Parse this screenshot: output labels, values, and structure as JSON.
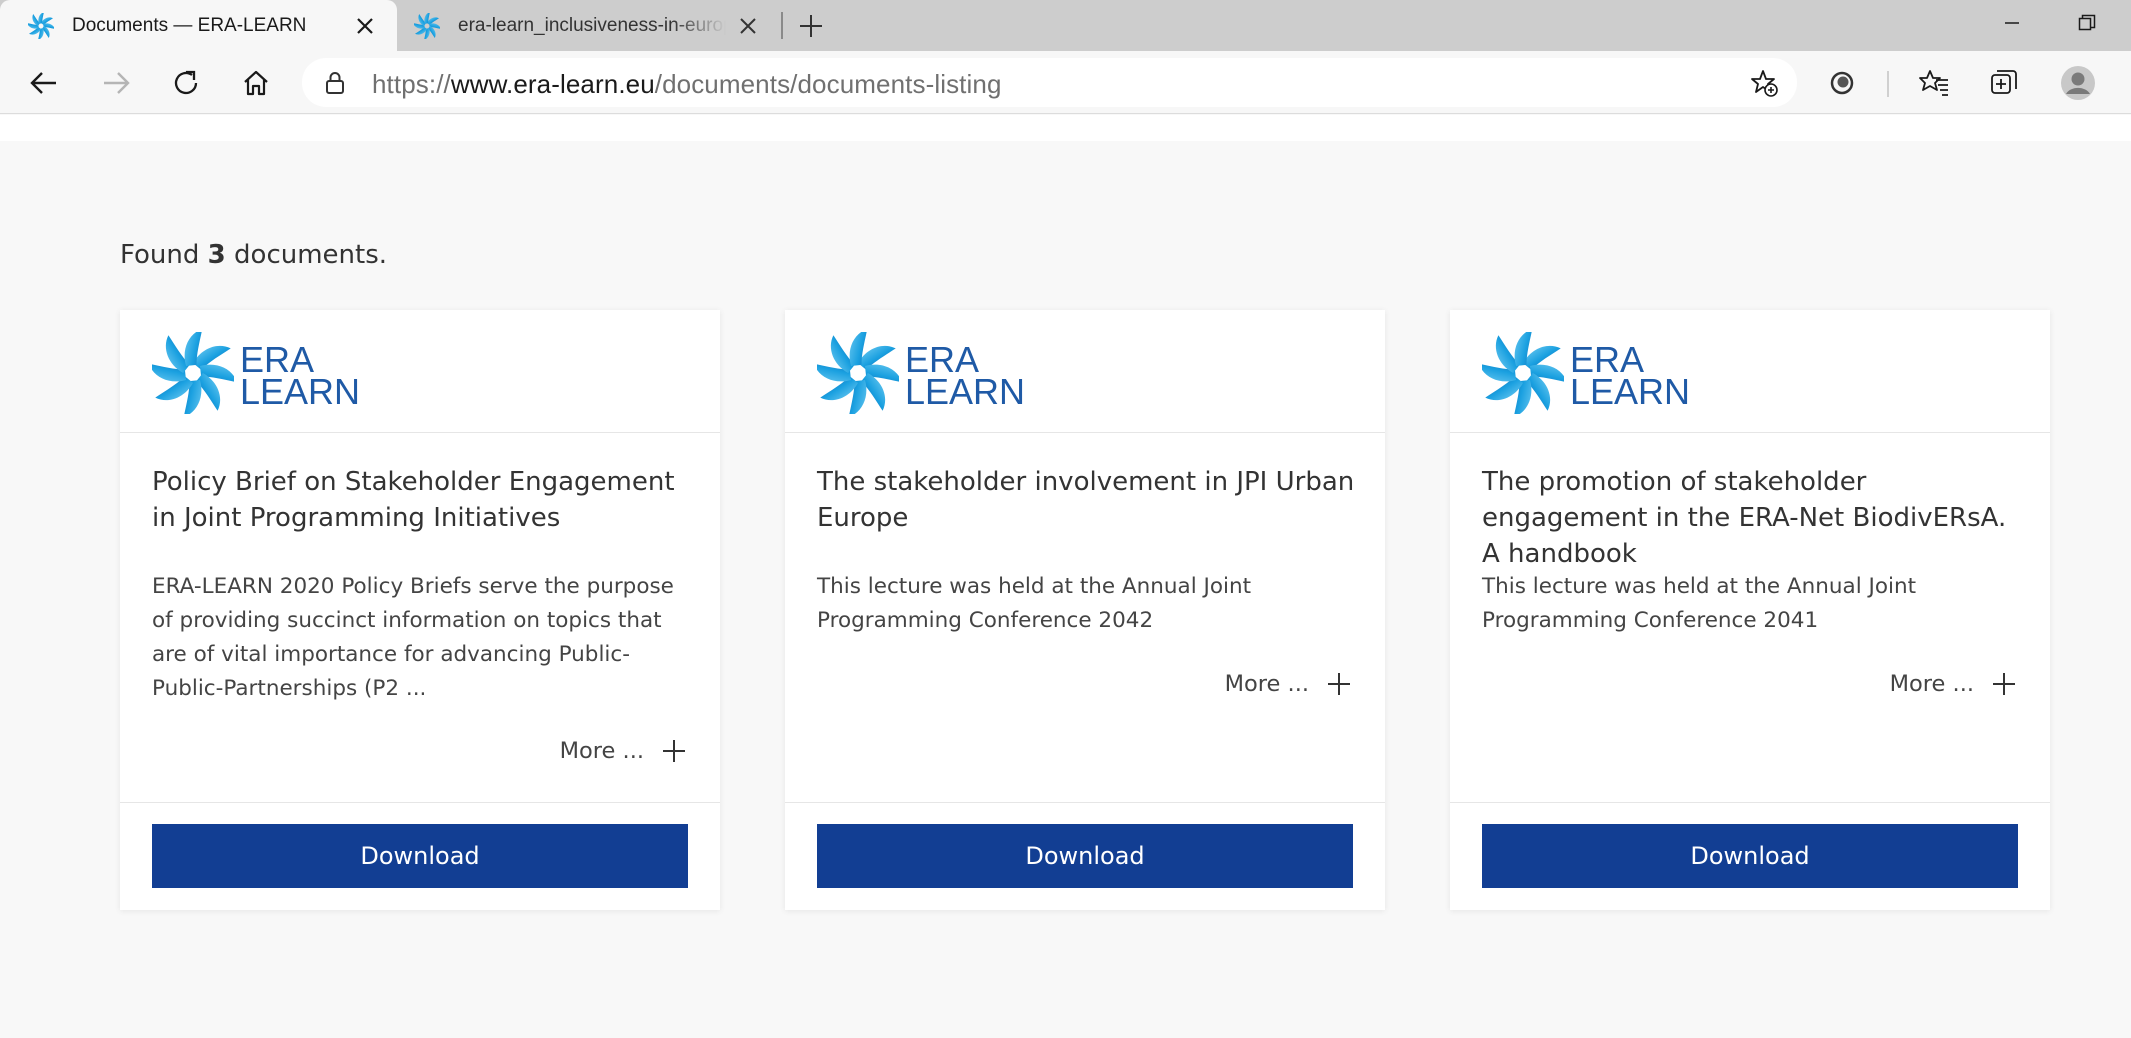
{
  "browser": {
    "tabs": [
      {
        "title": "Documents — ERA-LEARN",
        "active": true
      },
      {
        "title": "era-learn_inclusiveness-in-europe",
        "active": false
      }
    ],
    "address": {
      "scheme": "https://",
      "host": "www.era-learn.eu",
      "path": "/documents/documents-listing"
    },
    "icons": [
      "back-icon",
      "forward-icon",
      "refresh-icon",
      "home-icon",
      "lock-icon",
      "add-favorite-icon",
      "extension-icon",
      "favorites-icon",
      "collections-icon",
      "profile-icon"
    ]
  },
  "listing": {
    "found_prefix": "Found ",
    "found_count": "3",
    "found_suffix": " documents."
  },
  "logo": {
    "line1": "ERA",
    "line2": "LEARN"
  },
  "cards": [
    {
      "title": "Policy Brief on Stakeholder Engagement in Joint Programming Initiatives",
      "description": "ERA-LEARN 2020 Policy Briefs serve the purpose of providing succinct information on topics that are of vital importance for advancing Public-Public-Partnerships (P2 ...",
      "more_label": "More ...",
      "download_label": "Download"
    },
    {
      "title": "The stakeholder involvement in JPI Urban Europe",
      "description": "This lecture was held at the Annual Joint Programming Conference 2042",
      "more_label": "More ...",
      "download_label": "Download"
    },
    {
      "title": "The promotion of stakeholder engagement in the ERA-Net BiodivERsA. A handbook",
      "description": "This lecture was held at the Annual Joint Programming Conference 2041",
      "more_label": "More ...",
      "download_label": "Download"
    }
  ],
  "colors": {
    "download_button": "#123e93",
    "logo_text": "#1f5aa6",
    "page_background": "#f8f8f8"
  }
}
